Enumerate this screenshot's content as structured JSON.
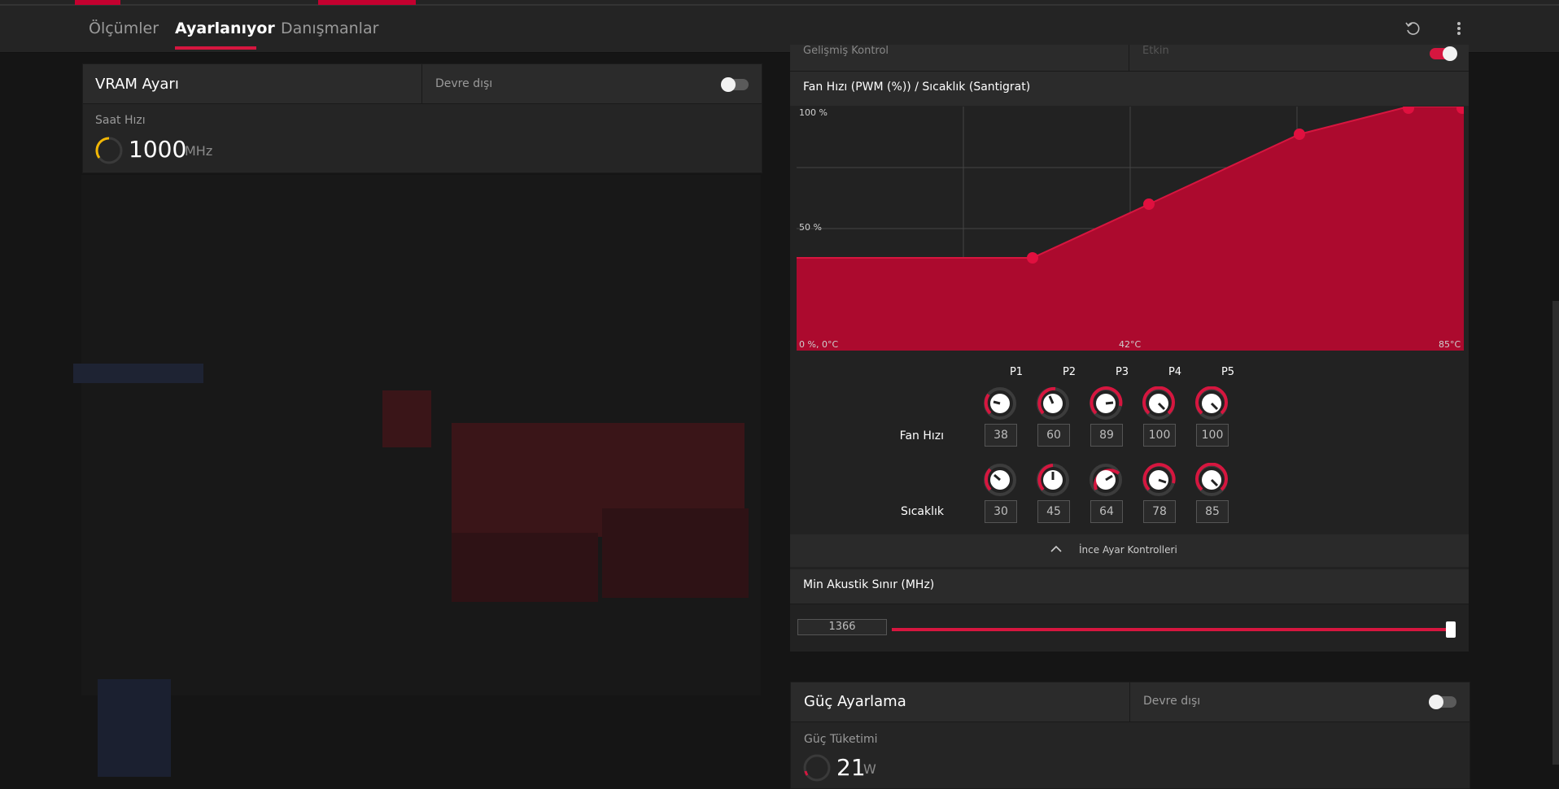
{
  "nav": {
    "tabs": [
      {
        "label": "Ölçümler"
      },
      {
        "label": "Ayarlanıyor"
      },
      {
        "label": "Danışmanlar"
      }
    ],
    "active_tab": "Ayarlanıyor"
  },
  "vram": {
    "title": "VRAM Ayarı",
    "state_label": "Devre dışı",
    "toggle_on": false,
    "clock_label": "Saat Hızı",
    "clock_value": "1000",
    "clock_unit": "MHz"
  },
  "advanced": {
    "label": "Gelişmiş Kontrol",
    "state_label": "Etkin",
    "toggle_on": true
  },
  "fan_curve": {
    "title": "Fan Hızı (PWM (%)) / Sıcaklık (Santigrat)",
    "y_top_label": "100 %",
    "y_mid_label": "50 %",
    "origin_label": "0 %, 0°C",
    "x_mid_label": "42°C",
    "x_max_label": "85°C",
    "points": [
      {
        "label": "P1",
        "speed": "38",
        "temp": "30"
      },
      {
        "label": "P2",
        "speed": "60",
        "temp": "45"
      },
      {
        "label": "P3",
        "speed": "89",
        "temp": "64"
      },
      {
        "label": "P4",
        "speed": "100",
        "temp": "78"
      },
      {
        "label": "P5",
        "speed": "100",
        "temp": "85"
      }
    ],
    "row_speed_label": "Fan Hızı",
    "row_temp_label": "Sıcaklık",
    "fine_tune_label": "İnce Ayar Kontrolleri",
    "accent": "#c4002f"
  },
  "acoustic": {
    "title": "Min Akustik Sınır (MHz)",
    "value": "1366",
    "fill": 1.0
  },
  "power": {
    "title": "Güç Ayarlama",
    "state_label": "Devre dışı",
    "toggle_on": false,
    "consumption_label": "Güç Tüketimi",
    "consumption_value": "21",
    "consumption_unit": "W"
  }
}
